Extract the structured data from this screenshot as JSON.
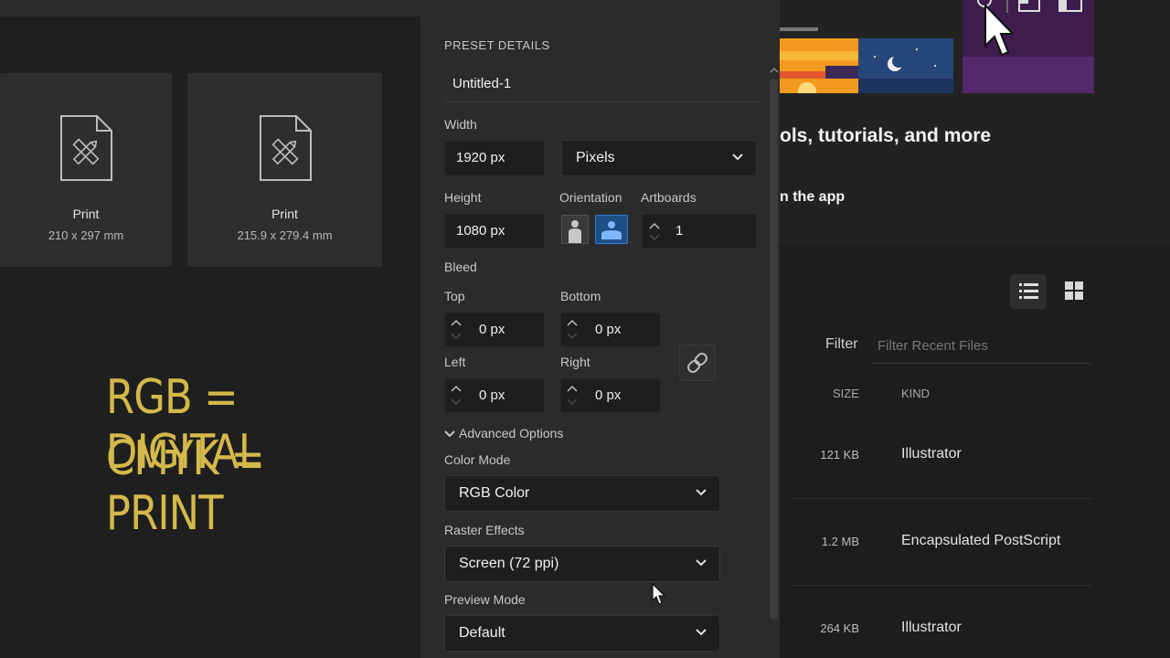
{
  "preset_cards": [
    {
      "title": "Print",
      "size": "210 x 297 mm"
    },
    {
      "title": "Print",
      "size": "215.9 x 279.4 mm"
    }
  ],
  "overlay": {
    "line1": "RGB = DIGITAL",
    "line2": "CMYK = PRINT"
  },
  "details": {
    "section_title": "PRESET DETAILS",
    "name": "Untitled-1",
    "width_label": "Width",
    "width_value": "1920 px",
    "units_value": "Pixels",
    "height_label": "Height",
    "height_value": "1080 px",
    "orientation_label": "Orientation",
    "artboards_label": "Artboards",
    "artboards_value": "1",
    "bleed_label": "Bleed",
    "top_label": "Top",
    "top_value": "0 px",
    "bottom_label": "Bottom",
    "bottom_value": "0 px",
    "left_label": "Left",
    "left_value": "0 px",
    "right_label": "Right",
    "right_value": "0 px",
    "advanced_label": "Advanced Options",
    "color_mode_label": "Color Mode",
    "color_mode_value": "RGB Color",
    "raster_label": "Raster Effects",
    "raster_value": "Screen (72 ppi)",
    "preview_label": "Preview Mode",
    "preview_value": "Default"
  },
  "right": {
    "headline": "ols, tutorials, and more",
    "subheadline": "n the app",
    "filter_label": "Filter",
    "filter_placeholder": "Filter Recent Files",
    "col_size": "SIZE",
    "col_kind": "KIND",
    "rows": [
      {
        "size": "121 KB",
        "kind": "Illustrator"
      },
      {
        "size": "1.2 MB",
        "kind": "Encapsulated PostScript"
      },
      {
        "size": "264 KB",
        "kind": "Illustrator"
      }
    ]
  },
  "colors": {
    "accent_blue": "#2d7fd6",
    "overlay_gold": "#d4b94a",
    "purple": "#3d1d4e"
  },
  "icons": [
    "document-ruler-pencil-icon",
    "chevron-down-icon",
    "stepper-arrows-icon",
    "portrait-icon",
    "landscape-icon",
    "link-icon",
    "list-view-icon",
    "grid-view-icon",
    "search-icon",
    "cursor-icon"
  ]
}
